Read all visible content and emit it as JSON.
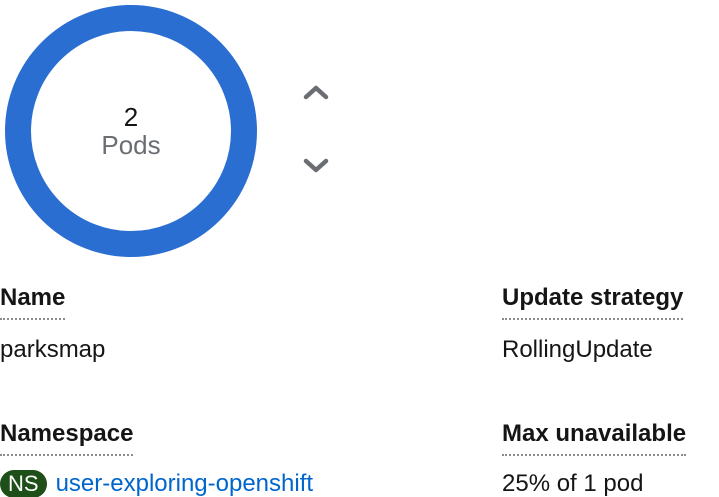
{
  "pods": {
    "count": "2",
    "unit": "Pods",
    "ring_color": "#2b6ed1"
  },
  "scale": {
    "up_icon": "chevron-up-icon",
    "down_icon": "chevron-down-icon",
    "icon_color": "#6a6e73"
  },
  "details": {
    "name_label": "Name",
    "name_value": "parksmap",
    "namespace_label": "Namespace",
    "namespace_badge": "NS",
    "namespace_value": "user-exploring-openshift",
    "strategy_label": "Update strategy",
    "strategy_value": "RollingUpdate",
    "max_unavailable_label": "Max unavailable",
    "max_unavailable_value": "25% of 1 pod"
  }
}
